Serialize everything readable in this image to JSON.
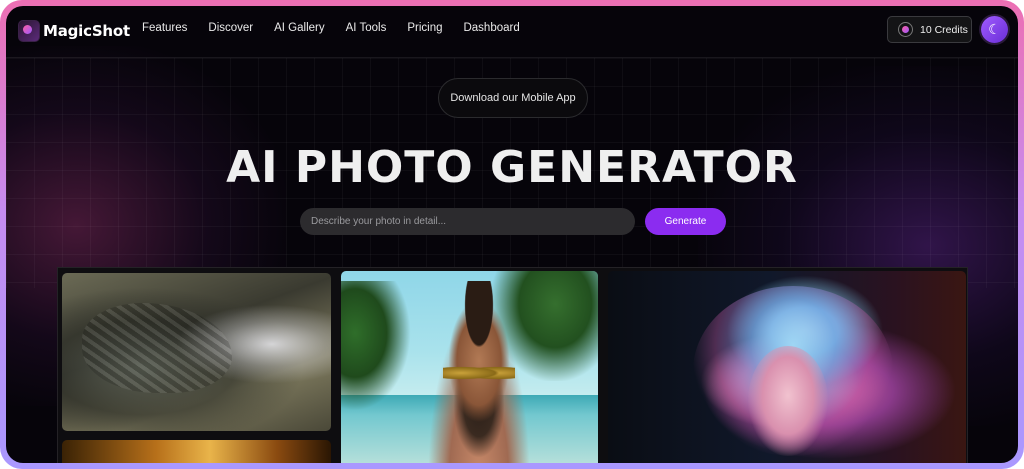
{
  "brand": {
    "name": "MagicShot"
  },
  "nav": {
    "items": [
      "Features",
      "Discover",
      "AI Gallery",
      "AI Tools",
      "Pricing",
      "Dashboard"
    ],
    "credits_label": "10 Credits"
  },
  "hero": {
    "app_button": "Download our Mobile App",
    "title": "AI PHOTO GENERATOR",
    "prompt_placeholder": "Describe your photo in detail...",
    "generate_label": "Generate"
  },
  "colors": {
    "accent": "#8b2cf0",
    "background": "#06040a",
    "frame_top": "#ec6fb3",
    "frame_bottom": "#a998ff"
  },
  "gallery": {
    "images": [
      "dragon-white-hair-image",
      "man-sunglasses-beach-image",
      "neon-woman-portrait-image",
      "golden-fire-image"
    ]
  }
}
